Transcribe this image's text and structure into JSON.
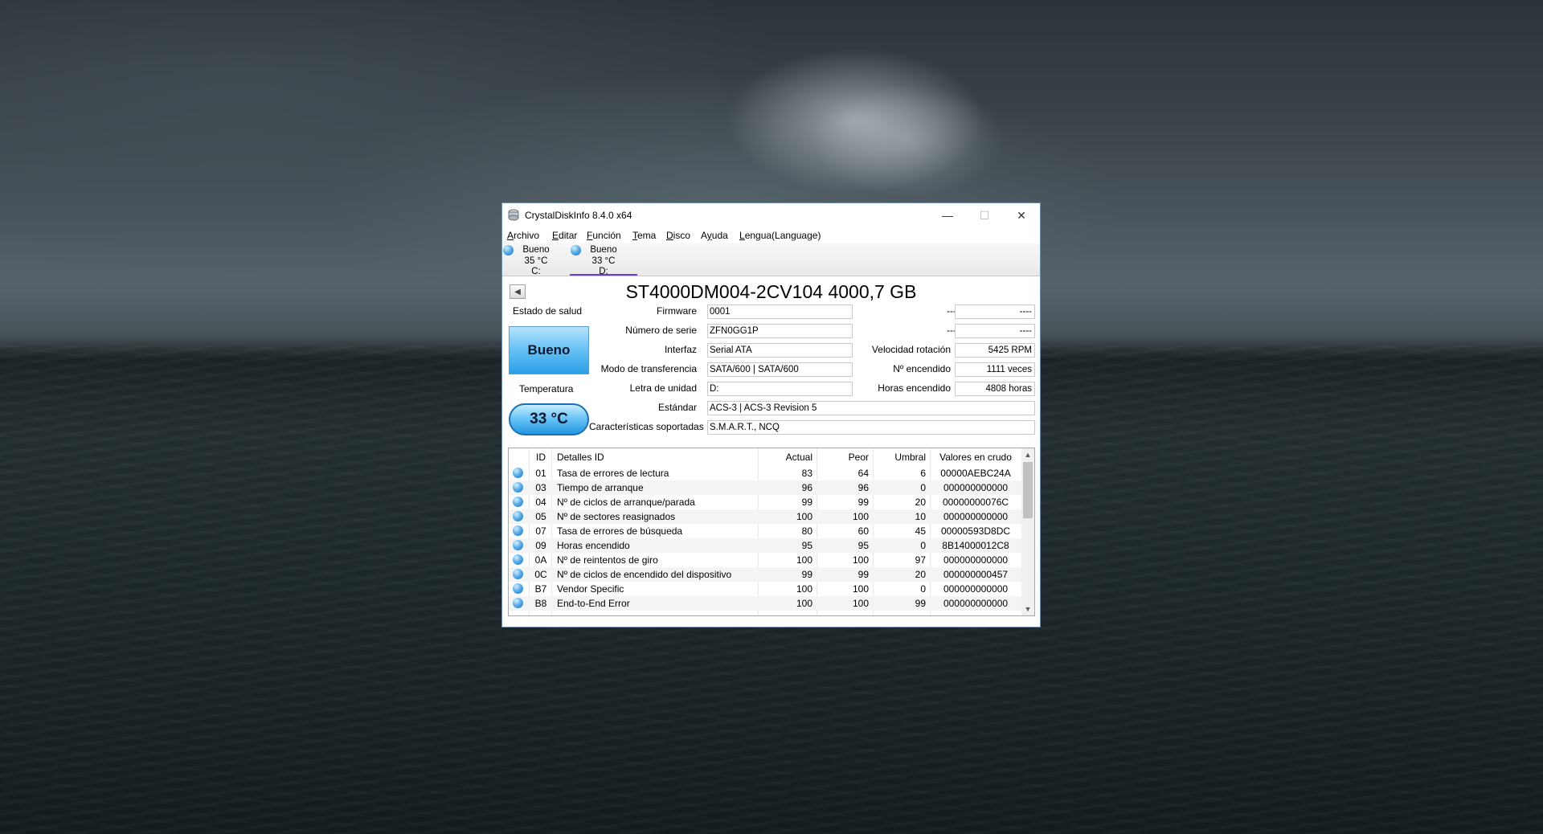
{
  "window": {
    "title": "CrystalDiskInfo 8.4.0 x64",
    "minimize_glyph": "—",
    "maximize_glyph": "☐",
    "close_glyph": "✕"
  },
  "menu": [
    {
      "pre": "",
      "acc": "A",
      "post": "rchivo"
    },
    {
      "pre": "",
      "acc": "E",
      "post": "ditar"
    },
    {
      "pre": "",
      "acc": "F",
      "post": "unción"
    },
    {
      "pre": "",
      "acc": "T",
      "post": "ema"
    },
    {
      "pre": "",
      "acc": "D",
      "post": "isco"
    },
    {
      "pre": "A",
      "acc": "y",
      "post": "uda"
    },
    {
      "pre": "",
      "acc": "L",
      "post": "engua(Language)"
    }
  ],
  "drives": [
    {
      "status": "Bueno",
      "temp": "35 °C",
      "letter": "C:",
      "active": false
    },
    {
      "status": "Bueno",
      "temp": "33 °C",
      "letter": "D:",
      "active": true
    }
  ],
  "disk": {
    "back_glyph": "◀",
    "model": "ST4000DM004-2CV104 4000,7 GB",
    "health_label": "Estado de salud",
    "health_value": "Bueno",
    "temp_label": "Temperatura",
    "temp_value": "33 °C",
    "firmware_label": "Firmware",
    "firmware": "0001",
    "serial_label": "Número de serie",
    "serial": "ZFN0GG1P",
    "interface_label": "Interfaz",
    "interface": "Serial ATA",
    "transfer_label": "Modo de transferencia",
    "transfer": "SATA/600 | SATA/600",
    "letter_label": "Letra de unidad",
    "letter": "D:",
    "standard_label": "Estándar",
    "standard": "ACS-3 | ACS-3 Revision 5",
    "features_label": "Características soportadas",
    "features": "S.M.A.R.T., NCQ",
    "blank1_label": "----",
    "blank1_value": "----",
    "blank2_label": "----",
    "blank2_value": "----",
    "rotation_label": "Velocidad rotación",
    "rotation": "5425 RPM",
    "power_count_label": "Nº encendido",
    "power_count": "1111 veces",
    "power_hours_label": "Horas encendido",
    "power_hours": "4808 horas"
  },
  "smart": {
    "columns": [
      "ID",
      "Detalles ID",
      "Actual",
      "Peor",
      "Umbral",
      "Valores en crudo"
    ],
    "rows": [
      {
        "id": "01",
        "name": "Tasa de errores de lectura",
        "current": "83",
        "worst": "64",
        "threshold": "6",
        "raw": "00000AEBC24A"
      },
      {
        "id": "03",
        "name": "Tiempo de arranque",
        "current": "96",
        "worst": "96",
        "threshold": "0",
        "raw": "000000000000"
      },
      {
        "id": "04",
        "name": "Nº de ciclos de arranque/parada",
        "current": "99",
        "worst": "99",
        "threshold": "20",
        "raw": "00000000076C"
      },
      {
        "id": "05",
        "name": "Nº de sectores reasignados",
        "current": "100",
        "worst": "100",
        "threshold": "10",
        "raw": "000000000000"
      },
      {
        "id": "07",
        "name": "Tasa de errores de búsqueda",
        "current": "80",
        "worst": "60",
        "threshold": "45",
        "raw": "00000593D8DC"
      },
      {
        "id": "09",
        "name": "Horas encendido",
        "current": "95",
        "worst": "95",
        "threshold": "0",
        "raw": "8B14000012C8"
      },
      {
        "id": "0A",
        "name": "Nº de reintentos de giro",
        "current": "100",
        "worst": "100",
        "threshold": "97",
        "raw": "000000000000"
      },
      {
        "id": "0C",
        "name": "Nº de ciclos de encendido del dispositivo",
        "current": "99",
        "worst": "99",
        "threshold": "20",
        "raw": "000000000457"
      },
      {
        "id": "B7",
        "name": "Vendor Specific",
        "current": "100",
        "worst": "100",
        "threshold": "0",
        "raw": "000000000000"
      },
      {
        "id": "B8",
        "name": "End-to-End Error",
        "current": "100",
        "worst": "100",
        "threshold": "99",
        "raw": "000000000000"
      }
    ],
    "scroll_up_glyph": "▲",
    "scroll_down_glyph": "▼"
  }
}
